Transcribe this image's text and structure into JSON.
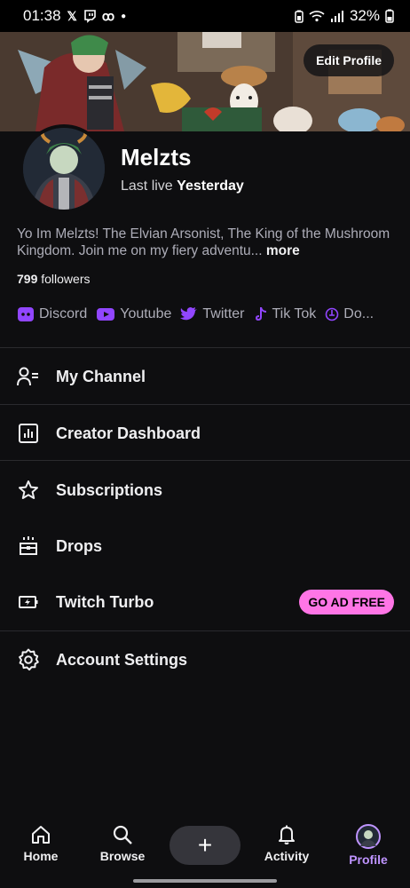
{
  "status_bar": {
    "time": "01:38",
    "battery": "32%"
  },
  "banner": {
    "edit_profile_label": "Edit Profile"
  },
  "profile": {
    "username": "Melzts",
    "last_live_prefix": "Last live",
    "last_live_value": "Yesterday",
    "bio": "Yo Im Melzts! The Elvian Arsonist, The King of the Mushroom Kingdom. Join me on my fiery adventu...",
    "bio_more": "more",
    "followers_count": "799",
    "followers_label": "followers"
  },
  "socials": [
    {
      "label": "Discord",
      "icon": "discord-icon"
    },
    {
      "label": "Youtube",
      "icon": "youtube-icon"
    },
    {
      "label": "Twitter",
      "icon": "twitter-icon"
    },
    {
      "label": "Tik Tok",
      "icon": "tiktok-icon"
    },
    {
      "label": "Do...",
      "icon": "donate-icon"
    }
  ],
  "menu": {
    "my_channel": "My Channel",
    "creator_dashboard": "Creator Dashboard",
    "subscriptions": "Subscriptions",
    "drops": "Drops",
    "twitch_turbo": "Twitch Turbo",
    "go_ad_free": "GO AD FREE",
    "account_settings": "Account Settings"
  },
  "nav": {
    "home": "Home",
    "browse": "Browse",
    "create": "+",
    "activity": "Activity",
    "profile": "Profile"
  },
  "colors": {
    "accent": "#bf94ff",
    "background": "#0e0e10",
    "ad_free_pill": "#ff75e6",
    "twitch_purple": "#9146ff"
  }
}
